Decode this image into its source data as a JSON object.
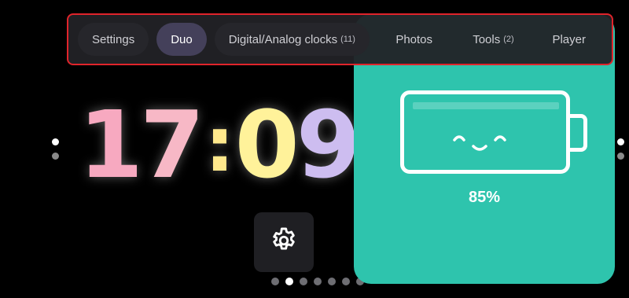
{
  "tabs": [
    {
      "label": "Settings",
      "count": ""
    },
    {
      "label": "Duo",
      "count": ""
    },
    {
      "label": "Digital/Analog clocks",
      "count": "(11)"
    },
    {
      "label": "Photos",
      "count": ""
    },
    {
      "label": "Tools",
      "count": "(2)"
    },
    {
      "label": "Player",
      "count": ""
    }
  ],
  "active_tab": "Duo",
  "clock": {
    "h1": "1",
    "h2": "7",
    "colon": ":",
    "m1": "0",
    "m2": "9"
  },
  "battery": {
    "percent_label": "85%",
    "level": 0.85,
    "color": "#2ec4ad"
  },
  "page_indicator": {
    "total": 7,
    "active_index": 1
  },
  "icons": {
    "settings": "gear-icon",
    "battery": "battery-icon",
    "face": "smiley-face-icon"
  },
  "colors": {
    "background": "#000000",
    "highlight_border": "#e0242b"
  }
}
